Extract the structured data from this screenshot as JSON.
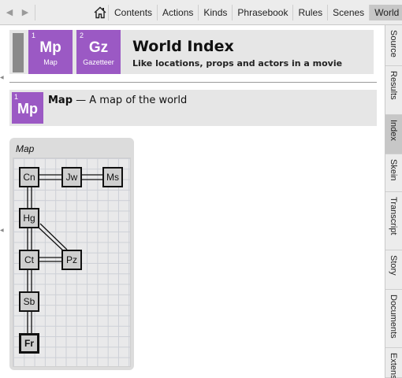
{
  "toolbar": {
    "tabs": [
      {
        "label": "Contents"
      },
      {
        "label": "Actions"
      },
      {
        "label": "Kinds"
      },
      {
        "label": "Phrasebook"
      },
      {
        "label": "Rules"
      },
      {
        "label": "Scenes"
      },
      {
        "label": "World",
        "active": true
      }
    ],
    "icons": {
      "back": "left-arrow-icon",
      "forward": "right-arrow-icon",
      "home": "home-icon"
    }
  },
  "side_tabs": [
    {
      "label": "Source"
    },
    {
      "label": "Results"
    },
    {
      "label": "Index",
      "active": true
    },
    {
      "label": "Skein"
    },
    {
      "label": "Transcript"
    },
    {
      "label": "Story"
    },
    {
      "label": "Documents"
    },
    {
      "label": "Extensions"
    }
  ],
  "header": {
    "tiles": [
      {
        "number": "1",
        "symbol": "Mp",
        "caption": "Map"
      },
      {
        "number": "2",
        "symbol": "Gz",
        "caption": "Gazetteer"
      }
    ],
    "title": "World Index",
    "subtitle": "Like locations, props and actors in a movie"
  },
  "entry": {
    "number": "1",
    "symbol": "Mp",
    "name": "Map",
    "description": " — A map of the world"
  },
  "map": {
    "title": "Map",
    "rooms": [
      {
        "code": "Cn"
      },
      {
        "code": "Jw"
      },
      {
        "code": "Ms"
      },
      {
        "code": "Hg"
      },
      {
        "code": "Ct"
      },
      {
        "code": "Pz"
      },
      {
        "code": "Sb"
      },
      {
        "code": "Fr",
        "current": true
      }
    ],
    "colors": {
      "tile": "#9b59c4",
      "node": "#cfcfcf",
      "grid": "#cdd0d6"
    }
  }
}
